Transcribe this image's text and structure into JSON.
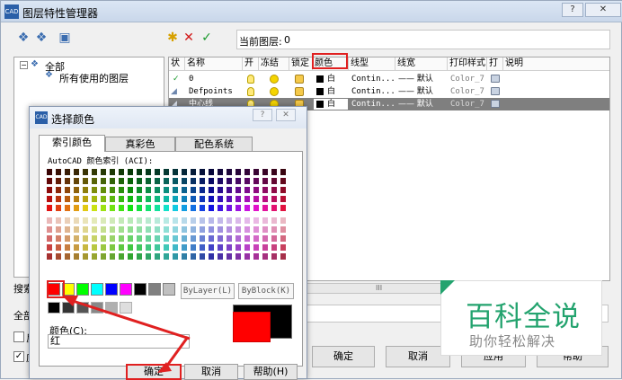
{
  "window": {
    "title": "图层特性管理器",
    "app_icon": "cad-icon"
  },
  "toolbar": {
    "current_layer_label": "当前图层:",
    "current_layer_value": "0"
  },
  "tree": {
    "root": "全部",
    "child": "所有使用的图层"
  },
  "columns": [
    "状",
    "名称",
    "开",
    "冻结",
    "锁定",
    "颜色",
    "线型",
    "线宽",
    "打印样式",
    "打",
    "说明"
  ],
  "layers": [
    {
      "status": "✓",
      "name": "0",
      "color": "白",
      "linetype": "Contin...",
      "lineweight": "—— 默认",
      "plotstyle": "Color_7"
    },
    {
      "status": "",
      "name": "Defpoints",
      "color": "白",
      "linetype": "Contin...",
      "lineweight": "—— 默认",
      "plotstyle": "Color_7"
    },
    {
      "status": "",
      "name": "中心线",
      "color": "白",
      "linetype": "Contin...",
      "lineweight": "—— 默认",
      "plotstyle": "Color_7"
    }
  ],
  "bottom": {
    "search_label": "搜索",
    "all_label": "全部",
    "scroll_marker": "III",
    "checkbox1": "反",
    "checkbox2": "应",
    "ok": "确定",
    "cancel": "取消",
    "apply": "应用",
    "help": "帮助"
  },
  "dialog": {
    "title": "选择颜色",
    "tabs": [
      "索引颜色",
      "真彩色",
      "配色系统"
    ],
    "aci_label": "AutoCAD 颜色索引 (ACI):",
    "bylayer": "ByLayer(L)",
    "byblock": "ByBlock(K)",
    "color_label": "颜色(C):",
    "color_value": "红",
    "ok": "确定",
    "cancel": "取消",
    "help": "帮助(H)"
  },
  "watermark": {
    "title": "百科全说",
    "subtitle": "助你轻松解决"
  },
  "colors": {
    "accent_red": "#e02020",
    "watermark_green": "#23a36e"
  }
}
